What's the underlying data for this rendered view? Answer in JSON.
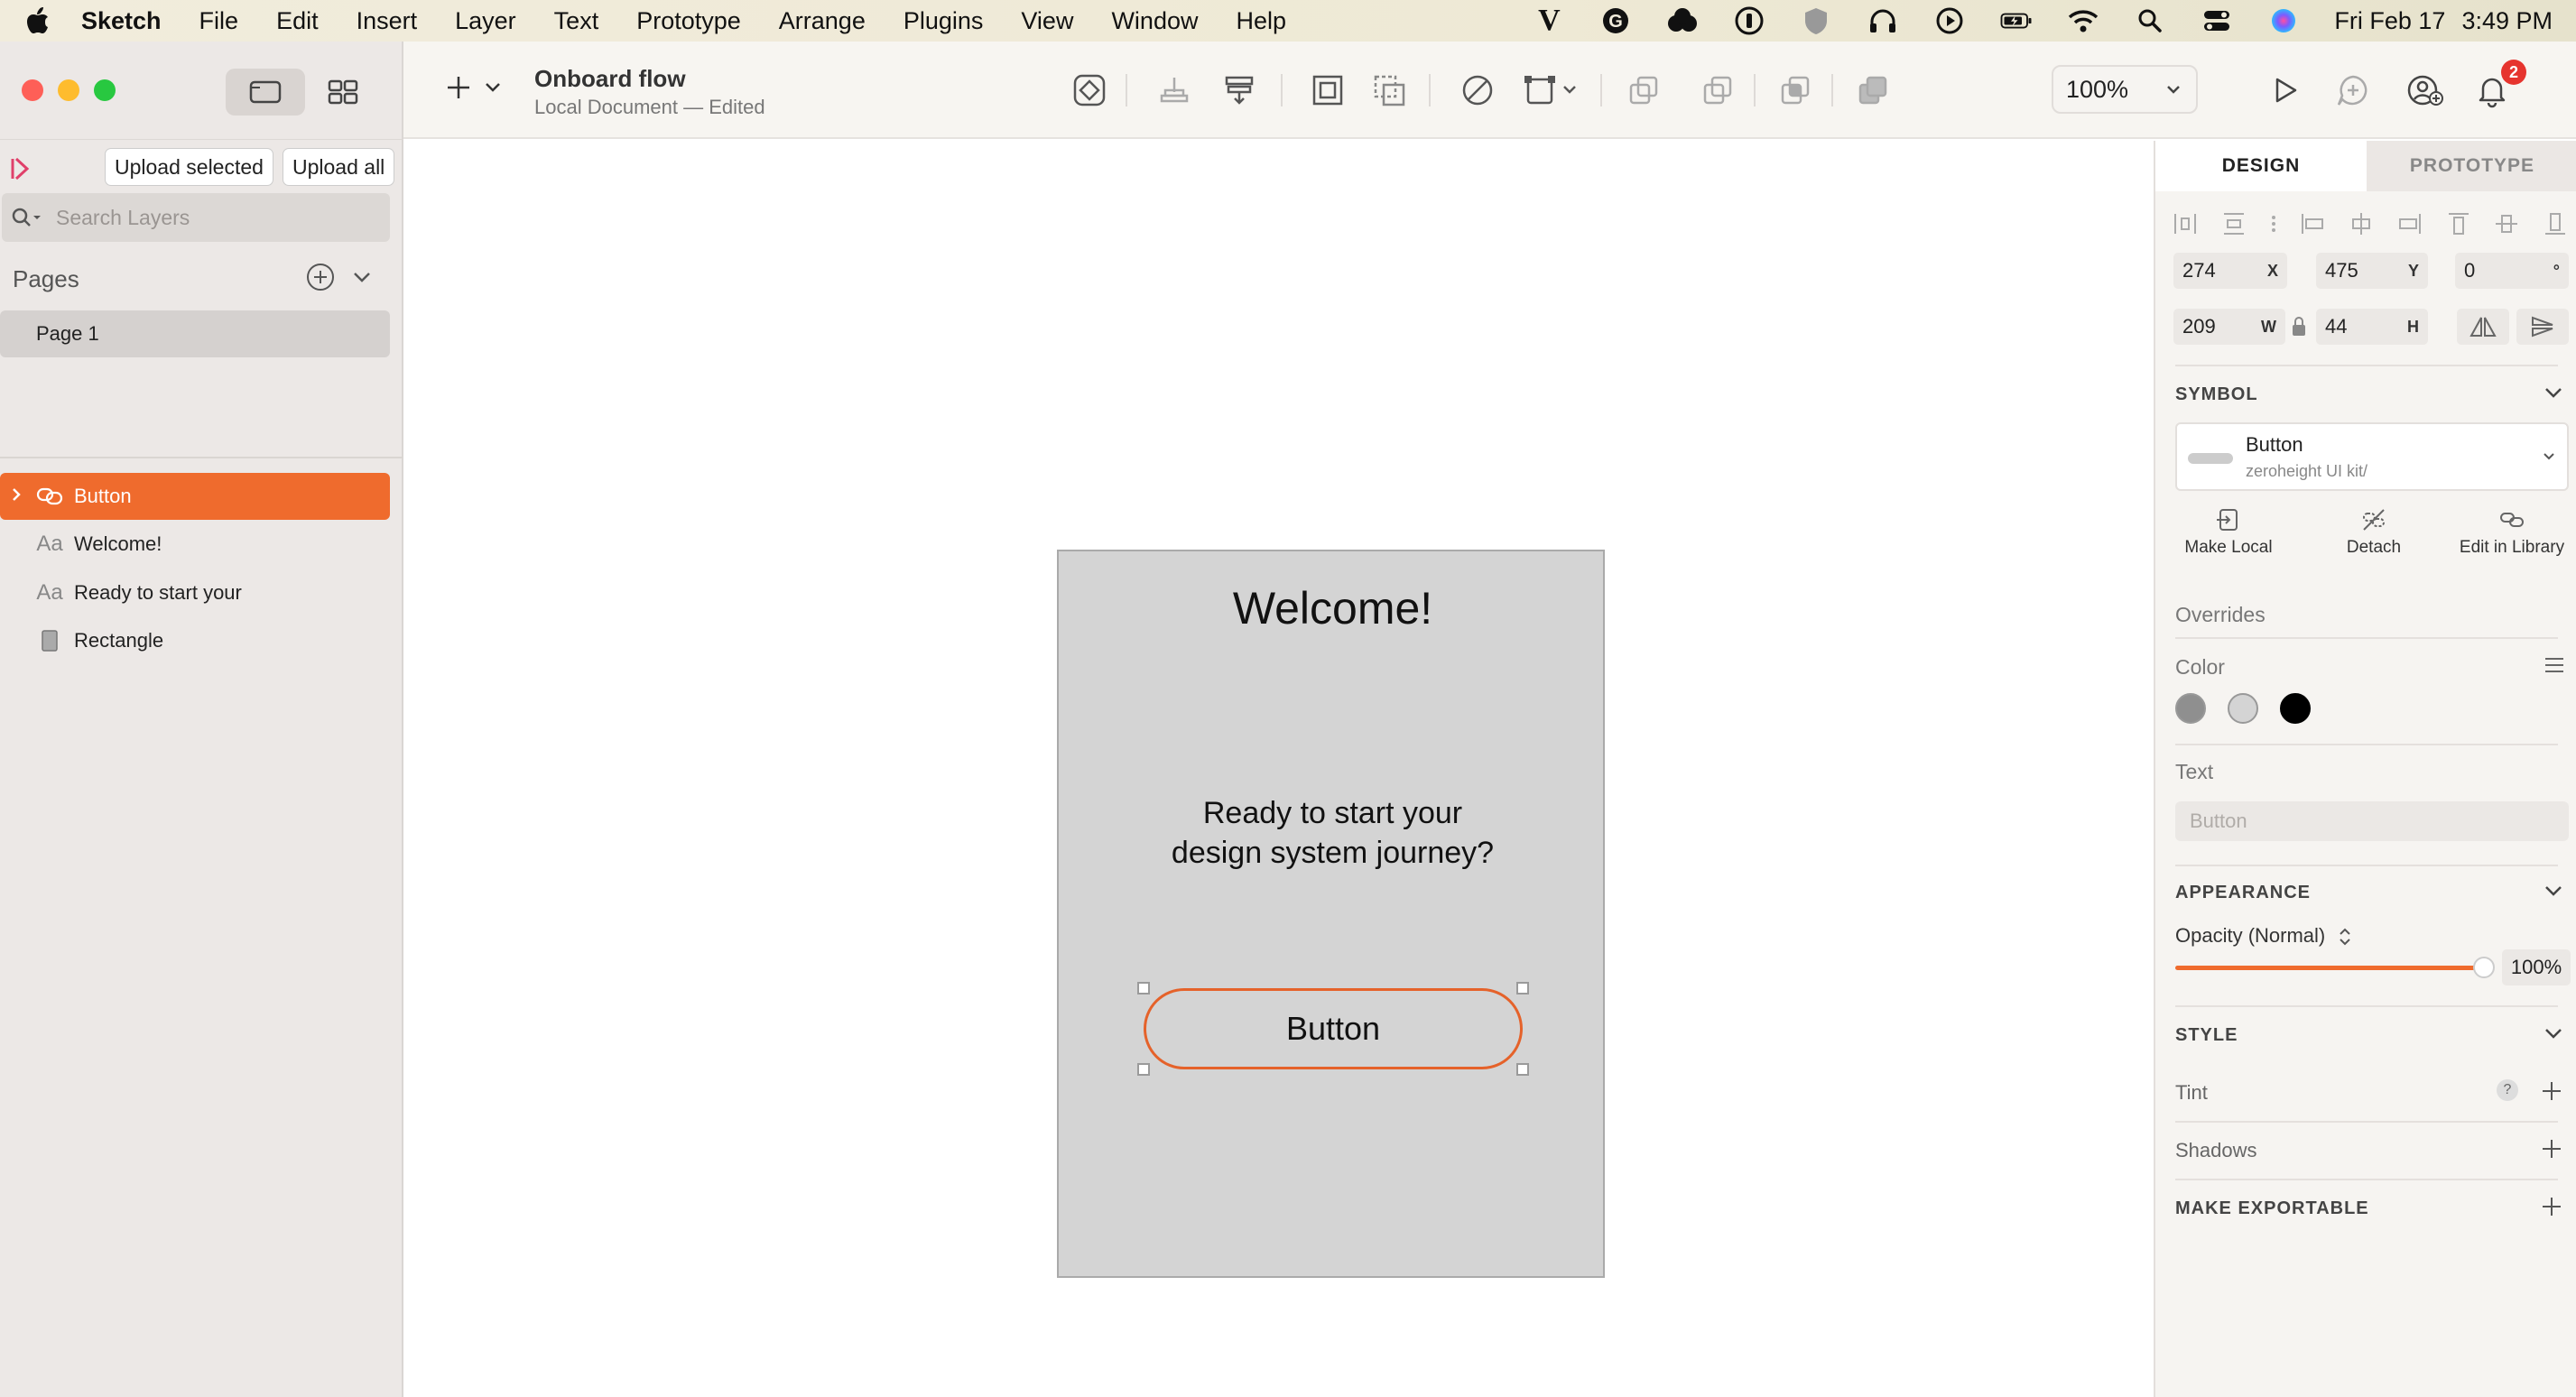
{
  "menubar": {
    "app_name": "Sketch",
    "items": [
      "File",
      "Edit",
      "Insert",
      "Layer",
      "Text",
      "Prototype",
      "Arrange",
      "Plugins",
      "View",
      "Window",
      "Help"
    ],
    "status_v": "V",
    "status_g": "G",
    "status_i": "i",
    "date": "Fri Feb 17",
    "time": "3:49 PM"
  },
  "sidebar": {
    "upload_selected": "Upload selected",
    "upload_all": "Upload all",
    "search_placeholder": "Search Layers",
    "pages_title": "Pages",
    "pages": [
      "Page 1"
    ],
    "layers": [
      {
        "name": "Button",
        "type": "symbol",
        "selected": true
      },
      {
        "name": "Welcome!",
        "type": "text"
      },
      {
        "name": "Ready to start your",
        "type": "text"
      },
      {
        "name": "Rectangle",
        "type": "rectangle"
      }
    ],
    "text_layer_glyph": "Aa"
  },
  "toolbar": {
    "doc_title": "Onboard flow",
    "doc_subtitle": "Local Document — Edited",
    "zoom": "100%",
    "notifications": "2"
  },
  "canvas": {
    "artboard_title": "Welcome!",
    "artboard_text_line1": "Ready to start your",
    "artboard_text_line2": "design system journey?",
    "button_label": "Button"
  },
  "inspector": {
    "tab_design": "DESIGN",
    "tab_prototype": "PROTOTYPE",
    "x_value": "274",
    "x_label": "X",
    "y_value": "475",
    "y_label": "Y",
    "rotation_value": "0",
    "rotation_unit": "°",
    "w_value": "209",
    "w_label": "W",
    "h_value": "44",
    "h_label": "H",
    "symbol_section": "SYMBOL",
    "symbol_name": "Button",
    "symbol_path": "zeroheight UI kit/",
    "make_local": "Make Local",
    "detach": "Detach",
    "edit_in_library": "Edit in Library",
    "overrides": "Overrides",
    "color_label": "Color",
    "color_swatches": [
      "#8f8f8f",
      "#d4d4d4",
      "#000000"
    ],
    "text_label": "Text",
    "text_placeholder": "Button",
    "appearance_section": "APPEARANCE",
    "opacity_label": "Opacity (Normal)",
    "opacity_value": "100%",
    "opacity_level": 1.0,
    "style_section": "STYLE",
    "tint_label": "Tint",
    "tint_help": "?",
    "shadows_label": "Shadows",
    "make_exportable": "MAKE EXPORTABLE"
  },
  "colors": {
    "accent": "#ef6b2d",
    "selection_border": "#e5622a",
    "traffic_red": "#fe5f57",
    "traffic_yellow": "#febc2e",
    "traffic_green": "#28c840"
  }
}
